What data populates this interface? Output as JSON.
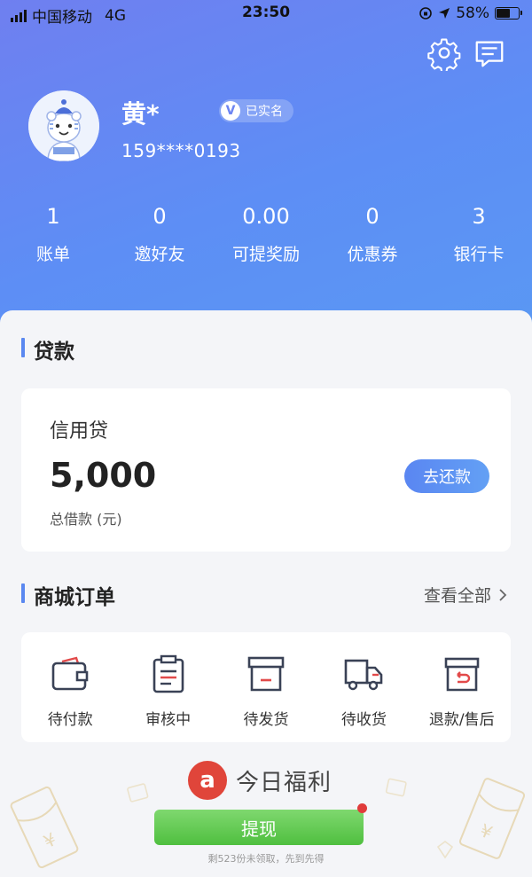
{
  "status_bar": {
    "carrier": "中国移动",
    "network": "4G",
    "time": "23:50",
    "battery": "58%"
  },
  "profile": {
    "name": "黄*",
    "verified_badge": "已实名",
    "badge_letter": "V",
    "phone": "159****0193"
  },
  "stats": [
    {
      "value": "1",
      "label": "账单"
    },
    {
      "value": "0",
      "label": "邀好友"
    },
    {
      "value": "0.00",
      "label": "可提奖励"
    },
    {
      "value": "0",
      "label": "优惠券"
    },
    {
      "value": "3",
      "label": "银行卡"
    }
  ],
  "loan_section": {
    "title": "贷款",
    "product": "信用贷",
    "amount": "5,000",
    "amount_label": "总借款 (元)",
    "repay_button": "去还款"
  },
  "orders_section": {
    "title": "商城订单",
    "view_all": "查看全部",
    "items": [
      {
        "label": "待付款",
        "icon": "wallet-icon"
      },
      {
        "label": "审核中",
        "icon": "clipboard-icon"
      },
      {
        "label": "待发货",
        "icon": "box-icon"
      },
      {
        "label": "待收货",
        "icon": "truck-icon"
      },
      {
        "label": "退款/售后",
        "icon": "return-box-icon"
      }
    ]
  },
  "welfare": {
    "logo_letter": "a",
    "title": "今日福利",
    "button": "提现",
    "note": "剩523份未领取，先到先得"
  },
  "colors": {
    "accent": "#5a88f0",
    "icon_dark": "#3a4256",
    "icon_red": "#e24a4a",
    "welfare_green": "#4fbf3f"
  }
}
